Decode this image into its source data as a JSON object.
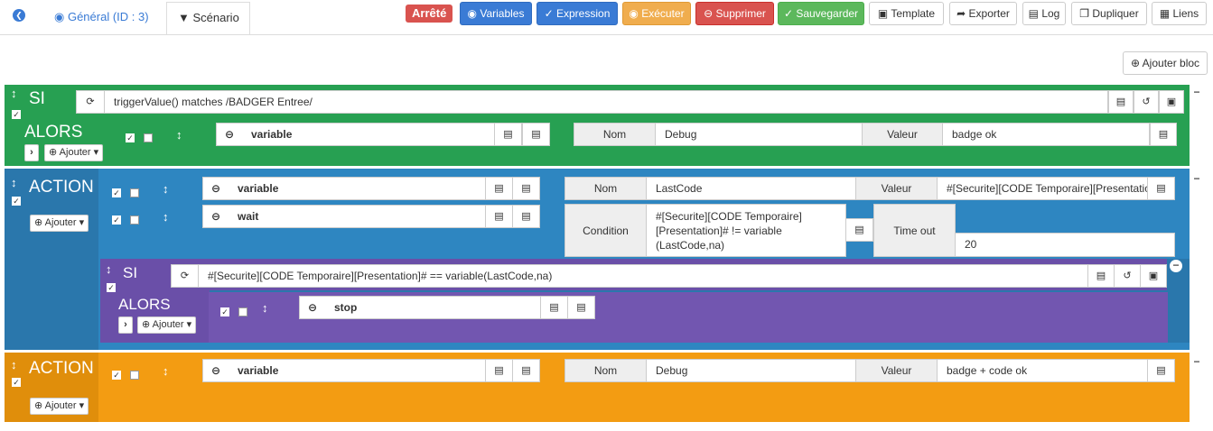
{
  "nav": {
    "general_tab": "Général (ID : 3)",
    "scenario_tab": "Scénario",
    "status": "Arrêté"
  },
  "toolbar": {
    "variables": "Variables",
    "expression": "Expression",
    "executer": "Exécuter",
    "supprimer": "Supprimer",
    "sauvegarder": "Sauvegarder",
    "template": "Template",
    "exporter": "Exporter",
    "log": "Log",
    "dupliquer": "Dupliquer",
    "liens": "Liens"
  },
  "add_bloc": "Ajouter bloc",
  "blocks": {
    "si1": {
      "keyword": "SI",
      "condition": "triggerValue() matches /BADGER Entree/",
      "alors": "ALORS",
      "ajouter": "Ajouter",
      "action": {
        "cmd": "variable",
        "nom_label": "Nom",
        "nom": "Debug",
        "valeur_label": "Valeur",
        "valeur": "badge ok"
      }
    },
    "action1": {
      "keyword": "ACTION",
      "ajouter": "Ajouter",
      "row1": {
        "cmd": "variable",
        "nom_label": "Nom",
        "nom": "LastCode",
        "valeur_label": "Valeur",
        "valeur": "#[Securite][CODE Temporaire][Presentatio"
      },
      "row2": {
        "cmd": "wait",
        "condition_label": "Condition",
        "condition_l1": "#[Securite][CODE Temporaire]",
        "condition_l2": "[Presentation]# != variable",
        "condition_l3": "(LastCode,na)",
        "timeout_label": "Time out",
        "timeout": "20"
      },
      "si2": {
        "keyword": "SI",
        "condition": "#[Securite][CODE Temporaire][Presentation]# == variable(LastCode,na)",
        "alors": "ALORS",
        "ajouter": "Ajouter",
        "cmd": "stop"
      }
    },
    "action2": {
      "keyword": "ACTION",
      "ajouter": "Ajouter",
      "row": {
        "cmd": "variable",
        "nom_label": "Nom",
        "nom": "Debug",
        "valeur_label": "Valeur",
        "valeur": "badge + code ok"
      }
    }
  },
  "colors": {
    "si": "#27a052",
    "action": "#2e86c1",
    "si_inner": "#7256b0",
    "action2": "#f39c12"
  }
}
